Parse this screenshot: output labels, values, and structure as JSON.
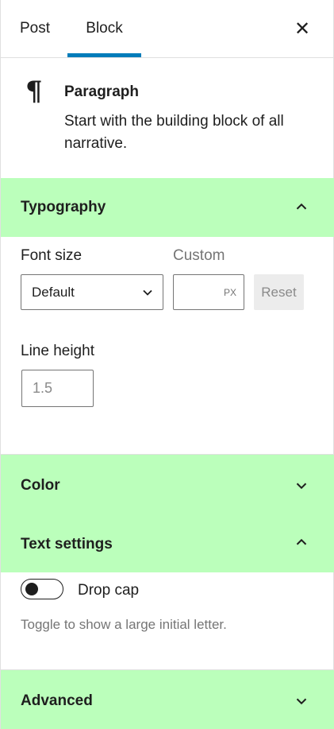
{
  "tabs": {
    "post_label": "Post",
    "block_label": "Block",
    "active": "Block"
  },
  "close_icon": "close-icon",
  "block_card": {
    "icon": "paragraph-icon",
    "icon_glyph": "¶",
    "title": "Paragraph",
    "description": "Start with the building block of all narrative."
  },
  "typography": {
    "title": "Typography",
    "expanded": true,
    "font_size_label": "Font size",
    "custom_label": "Custom",
    "font_size_value": "Default",
    "custom_value": "",
    "custom_unit": "PX",
    "reset_label": "Reset",
    "line_height_label": "Line height",
    "line_height_placeholder": "1.5"
  },
  "color": {
    "title": "Color",
    "expanded": false
  },
  "text_settings": {
    "title": "Text settings",
    "expanded": true,
    "drop_cap_label": "Drop cap",
    "drop_cap_on": false,
    "drop_cap_help": "Toggle to show a large initial letter."
  },
  "advanced": {
    "title": "Advanced",
    "expanded": false
  },
  "colors": {
    "accent": "#007cba",
    "panel_highlight": "#bbffbb",
    "text": "#1e1e1e",
    "muted": "#757575"
  }
}
